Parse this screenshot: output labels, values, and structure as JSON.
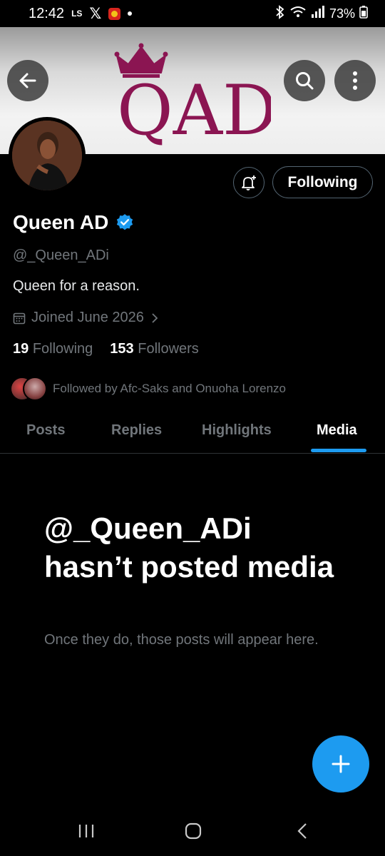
{
  "status_bar": {
    "time": "12:42",
    "carrier_badge": "LS",
    "x_glyph": "𝕏",
    "battery": "73%",
    "icons": [
      "x-app-icon",
      "man-utd-icon",
      "bluetooth-icon",
      "wifi-icon",
      "signal-icon",
      "battery-icon"
    ]
  },
  "banner": {
    "logo_text": "QAD",
    "colors": {
      "logo": "#8b1552",
      "crown": "#8b1552"
    }
  },
  "profile": {
    "display_name": "Queen AD",
    "handle": "@_Queen_ADi",
    "bio": "Queen for a reason.",
    "joined": "Joined June 2026",
    "following_count": "19",
    "following_label": "Following",
    "followers_count": "153",
    "followers_label": "Followers",
    "followed_by": "Followed by Afc-Saks and Onuoha Lorenzo",
    "verified": true
  },
  "actions": {
    "following_button": "Following"
  },
  "tabs": [
    {
      "label": "Posts",
      "active": false
    },
    {
      "label": "Replies",
      "active": false
    },
    {
      "label": "Highlights",
      "active": false
    },
    {
      "label": "Media",
      "active": true
    }
  ],
  "empty_state": {
    "title": "@_Queen_ADi hasn’t posted media",
    "subtitle": "Once they do, those posts will appear here."
  },
  "colors": {
    "accent": "#1d9bf0",
    "background": "#000000",
    "secondary_text": "#71767b"
  }
}
